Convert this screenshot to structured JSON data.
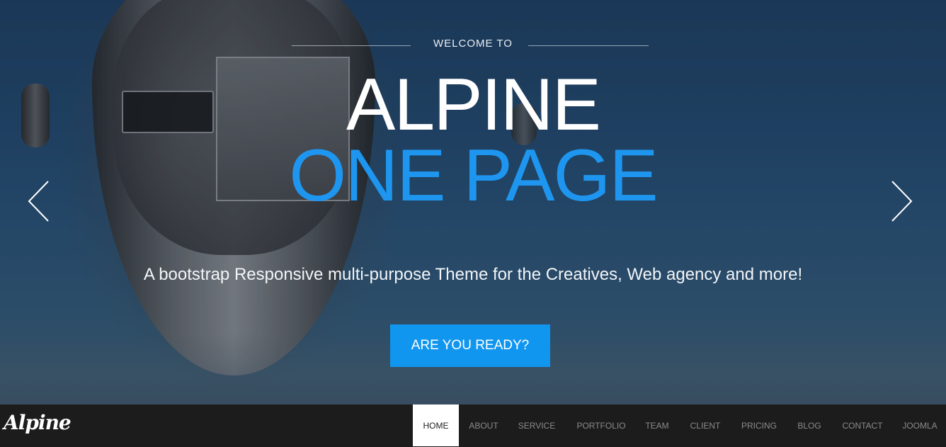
{
  "hero": {
    "welcome": "WELCOME TO",
    "title_line1": "ALPINE",
    "title_line2": "ONE PAGE",
    "tagline": "A bootstrap Responsive multi-purpose Theme for the Creatives, Web agency and more!",
    "cta_label": "ARE YOU READY?",
    "accent_color": "#1e96f0",
    "prev_icon": "chevron-left-icon",
    "next_icon": "chevron-right-icon"
  },
  "navbar": {
    "logo": "Alpine",
    "items": [
      "HOME",
      "ABOUT",
      "SERVICE",
      "PORTFOLIO",
      "TEAM",
      "CLIENT",
      "PRICING",
      "BLOG",
      "CONTACT",
      "JOOMLA"
    ],
    "active": "HOME"
  }
}
